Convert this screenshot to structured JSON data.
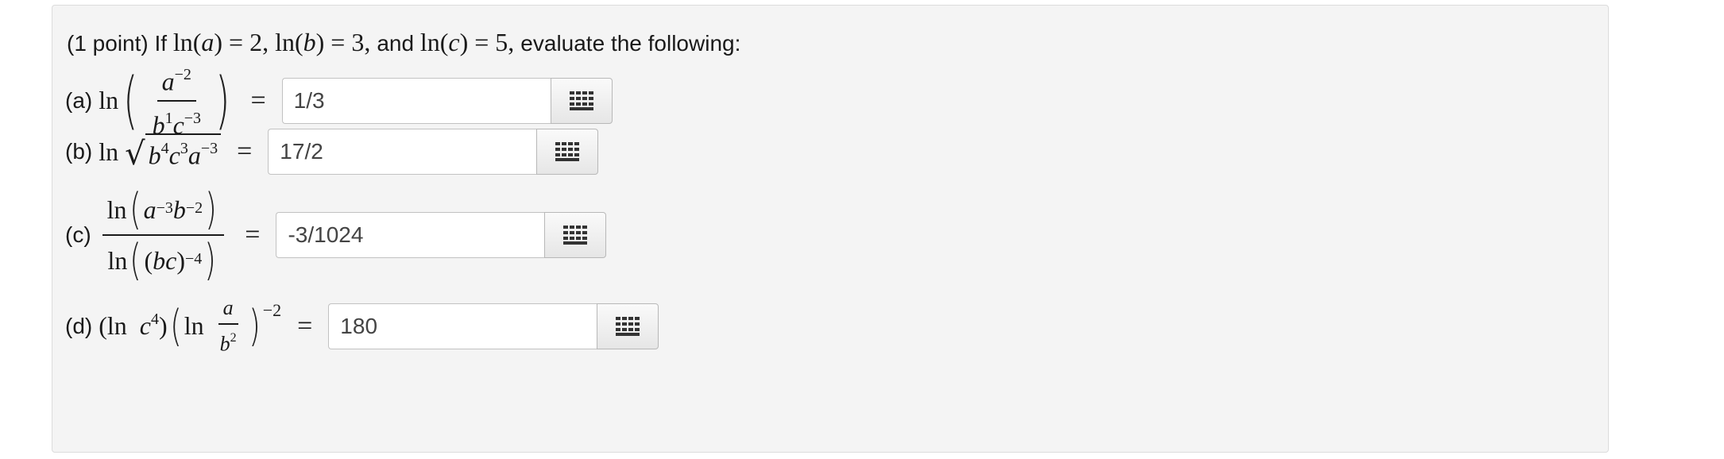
{
  "intro": {
    "prefix": "(1 point) If ",
    "cond_a": "ln(a) = 2, ",
    "cond_b": "ln(b) = 3, ",
    "and": "and ",
    "cond_c": "ln(c) = 5, ",
    "suffix": "evaluate the following:"
  },
  "parts": [
    {
      "label": "(a)",
      "answer": "1/3"
    },
    {
      "label": "(b)",
      "answer": "17/2"
    },
    {
      "label": "(c)",
      "answer": "-3/1024"
    },
    {
      "label": "(d)",
      "answer": "180"
    }
  ],
  "equals": "=",
  "icons": {
    "keypad": "keypad-grid-icon"
  }
}
